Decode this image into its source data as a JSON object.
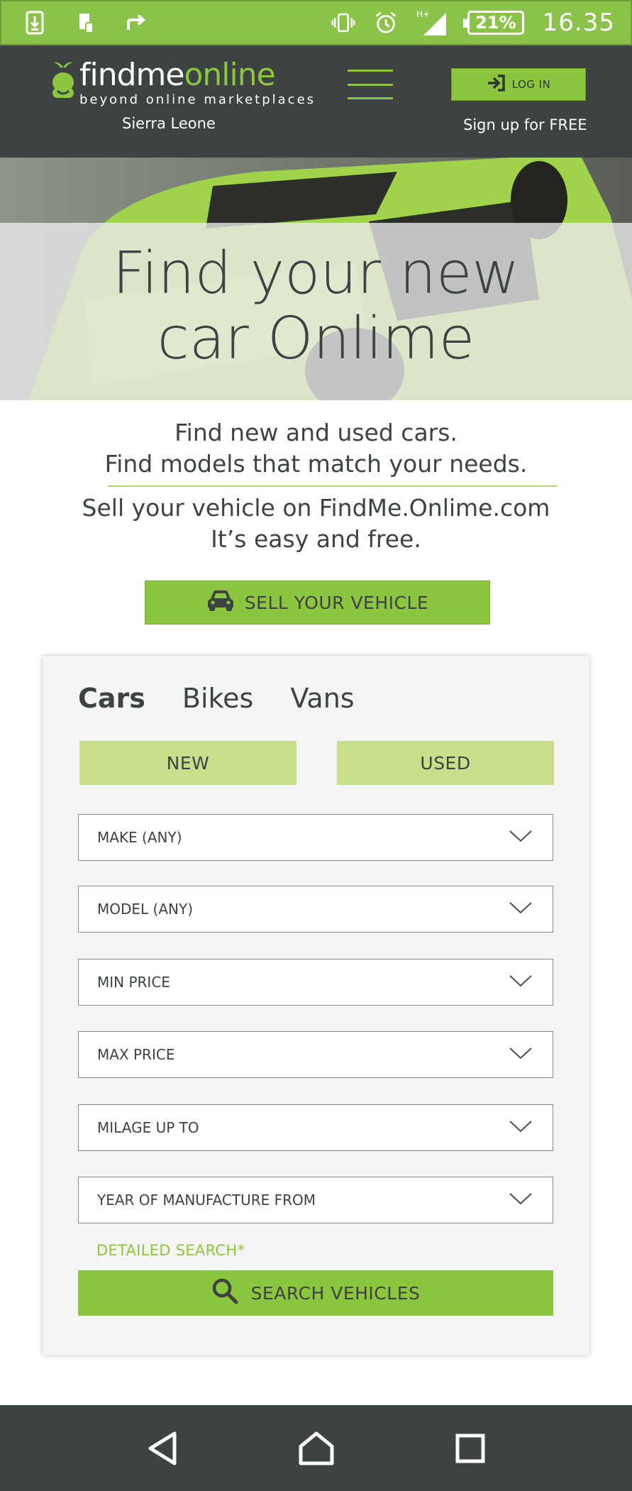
{
  "status_bar": {
    "battery": "21%",
    "time": "16.35",
    "network": "H+"
  },
  "header": {
    "logo_find": "findme",
    "logo_online": "online",
    "logo_tagline": "beyond online marketplaces",
    "region": "Sierra Leone",
    "login_label": "LOG IN",
    "signup_label": "Sign up for FREE"
  },
  "hero": {
    "title_line1": "Find your new",
    "title_line2": "car Onlime"
  },
  "intro": {
    "line1": "Find new and used cars.",
    "line2": "Find models that match your needs.",
    "line3": "Sell your vehicle on FindMe.Onlime.com",
    "line4": "It’s easy and free."
  },
  "sell_button_label": "SELL YOUR VEHICLE",
  "search": {
    "tabs": [
      {
        "label": "Cars",
        "active": true
      },
      {
        "label": "Bikes",
        "active": false
      },
      {
        "label": "Vans",
        "active": false
      }
    ],
    "condition_new": "NEW",
    "condition_used": "USED",
    "selects": [
      {
        "value": "MAKE (ANY)"
      },
      {
        "value": "MODEL (ANY)"
      },
      {
        "value": "MIN PRICE"
      },
      {
        "value": "MAX PRICE"
      },
      {
        "value": "MILAGE UP TO"
      },
      {
        "value": "YEAR OF MANUFACTURE FROM"
      }
    ],
    "detailed_label": "DETAILED SEARCH*",
    "search_label": "SEARCH VEHICLES"
  },
  "colors": {
    "brand_green": "#8cc63f",
    "light_green": "#c7df8c",
    "dark_gray": "#3d4242"
  },
  "icons": {
    "status_left": [
      "download-icon",
      "phone-icon",
      "share-icon"
    ],
    "status_right": [
      "vibrate-icon",
      "alarm-icon",
      "signal-icon",
      "battery-icon"
    ],
    "nav": [
      "back-icon",
      "home-icon",
      "recents-icon"
    ]
  }
}
